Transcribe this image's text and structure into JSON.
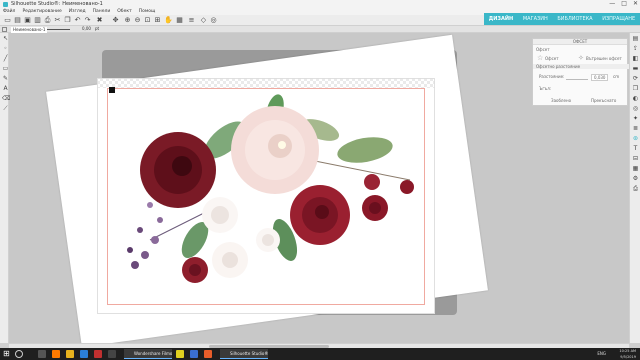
{
  "window": {
    "title": "Silhouette Studio®: Неименовано-1",
    "controls": [
      "—",
      "□",
      "✕"
    ]
  },
  "menu": [
    "Файл",
    "Редактирование",
    "Изглед",
    "Панели",
    "Обект",
    "Помощ"
  ],
  "toolbar": {
    "stroke_width": "0,00",
    "zoom_value": "pt"
  },
  "modes": [
    {
      "label": "ДИЗАЙН",
      "active": true
    },
    {
      "label": "МАГАЗИН",
      "active": false
    },
    {
      "label": "БИБЛИОТЕКА",
      "active": false
    },
    {
      "label": "ИЗПРАЩАНЕ",
      "active": false
    }
  ],
  "document": {
    "tab_label": "Неименовано-1"
  },
  "panel": {
    "title": "ОФСЕТ",
    "subtitle": "Офсет",
    "option_offset": "Офсет",
    "option_internal": "Вътрешен офсет",
    "section": "Офсетно разстояние",
    "distance_label": "Разстояние:",
    "distance_value": "0,030",
    "distance_unit": "cm",
    "corner_label": "Ъгъл:",
    "corner_round": "Заоблено",
    "corner_sharp": "Прекъснато"
  },
  "taskbar": {
    "apps": [
      "Wondershare Filmo...",
      "Silhouette Studio®..."
    ],
    "language": "ENG",
    "time": "10:25 AM",
    "date": "9/5/2019"
  },
  "colors": {
    "accent": "#3ab7c8",
    "cut_line": "#f0a9a0"
  }
}
